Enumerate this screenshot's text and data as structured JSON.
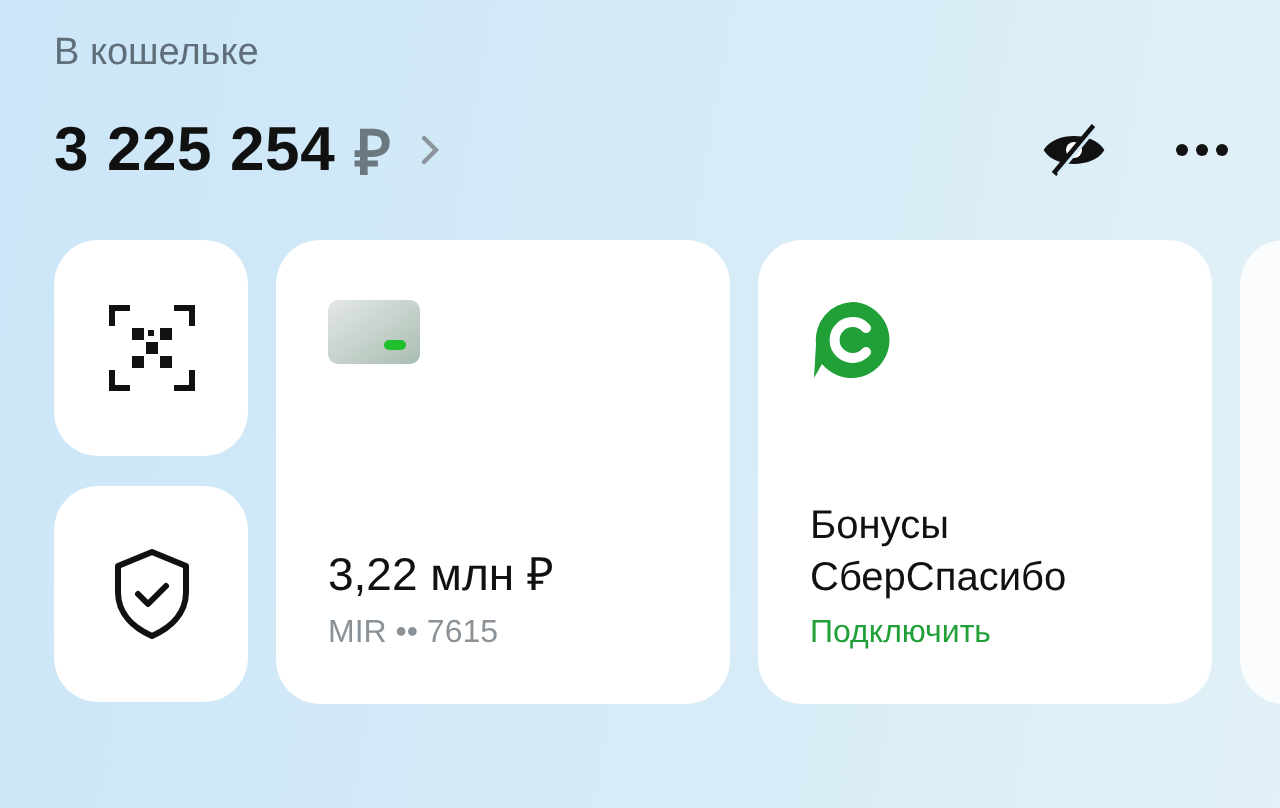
{
  "wallet": {
    "title": "В кошельке",
    "balance": {
      "amount": "3 225 254",
      "currency": "₽"
    },
    "balance_hidden": false
  },
  "quick_actions": [
    {
      "kind": "qr"
    },
    {
      "kind": "shield"
    }
  ],
  "cards": [
    {
      "kind": "bank_card",
      "amount": "3,22 млн ₽",
      "caption": "MIR •• 7615"
    },
    {
      "kind": "bonus",
      "title": "Бонусы СберСпасибо",
      "action": "Подключить"
    }
  ]
}
